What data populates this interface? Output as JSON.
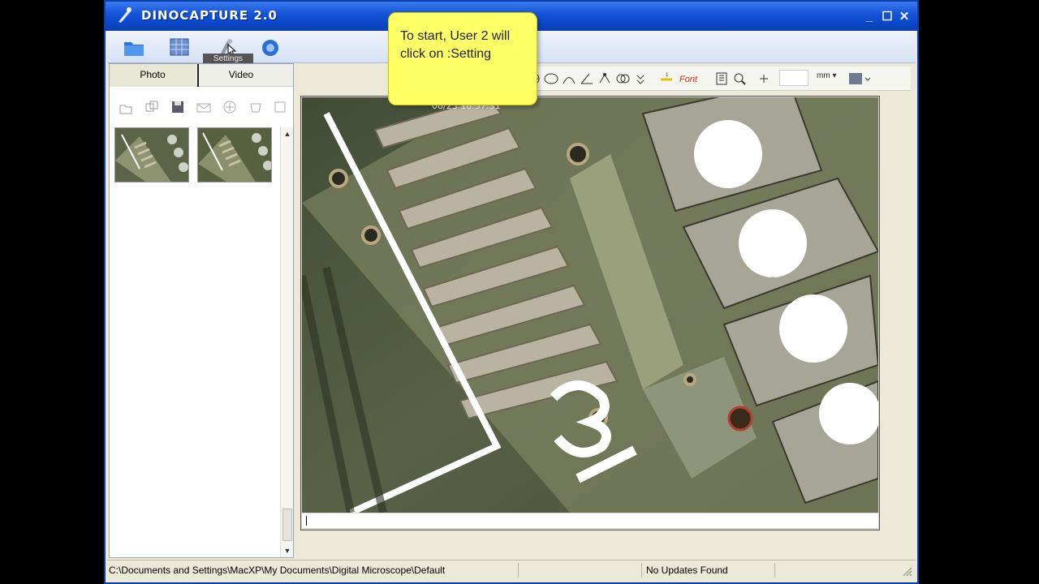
{
  "window": {
    "title": "DINOCAPTURE 2.0"
  },
  "toolbar": {
    "settings_tooltip": "Settings"
  },
  "tabs": {
    "photo": "Photo",
    "video": "Video"
  },
  "viewer": {
    "timestamp": "08/23 16:57:31"
  },
  "callout": {
    "text": "To start, User 2 will click on :Setting"
  },
  "measure_toolbar": {
    "unit": "mm"
  },
  "statusbar": {
    "path": "C:\\Documents and Settings\\MacXP\\My Documents\\Digital Microscope\\Default",
    "updates": "No Updates Found"
  },
  "colors": {
    "titlebar": "#0a46c8",
    "callout": "#ffff66",
    "pcb": "#5c6a4a"
  }
}
